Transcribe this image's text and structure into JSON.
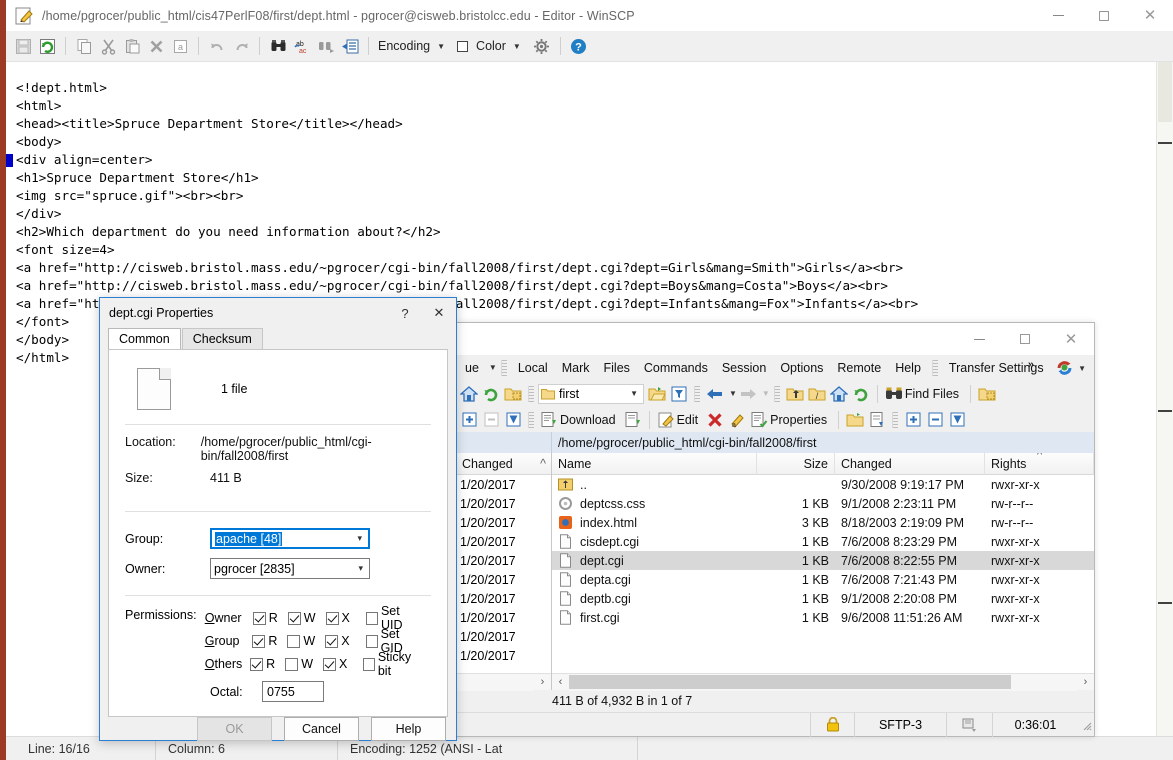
{
  "editor": {
    "title": "/home/pgrocer/public_html/cis47PerlF08/first/dept.html - pgrocer@cisweb.bristolcc.edu - Editor - WinSCP",
    "title_icon": "edit-pencil-icon",
    "toolbar": {
      "save_icon": "save-icon",
      "reload_icon": "reload-icon",
      "copy_icon": "copy-icon",
      "cut_icon": "cut-icon",
      "paste_icon": "paste-icon",
      "delete_icon": "delete-x-icon",
      "select_all_icon": "select-all-icon",
      "undo_icon": "undo-icon",
      "redo_icon": "redo-icon",
      "find_icon": "find-binoculars-icon",
      "replace_icon": "replace-icon",
      "find_next_icon": "find-next-icon",
      "goto_icon": "go-to-line-icon",
      "encoding_label": "Encoding",
      "color_label": "Color",
      "preferences_icon": "gear-icon",
      "help_icon": "help-question-icon"
    },
    "code_lines": [
      "<!dept.html>",
      "<html>",
      "<head><title>Spruce Department Store</title></head>",
      "<body>",
      "<div align=center>",
      "<h1>Spruce Department Store</h1>",
      "<img src=\"spruce.gif\"><br><br>",
      "</div>",
      "<h2>Which department do you need information about?</h2>",
      "<font size=4>",
      "<a href=\"http://cisweb.bristol.mass.edu/~pgrocer/cgi-bin/fall2008/first/dept.cgi?dept=Girls&mang=Smith\">Girls</a><br>",
      "<a href=\"http://cisweb.bristol.mass.edu/~pgrocer/cgi-bin/fall2008/first/dept.cgi?dept=Boys&mang=Costa\">Boys</a><br>",
      "<a href=\"http://cisweb.bristol.mass.edu/~pgrocer/cgi-bin/fall2008/first/dept.cgi?dept=Infants&mang=Fox\">Infants</a><br>",
      "</font>",
      "</body>",
      "</html>"
    ],
    "status": {
      "line": "Line: 16/16",
      "column": "Column: 6",
      "encoding": "Encoding: 1252 (ANSI - Lat"
    },
    "window_buttons": {
      "minimize": "minimize-button",
      "maximize": "maximize-button",
      "close": "close-button"
    }
  },
  "winscp": {
    "menus": [
      "Local",
      "Mark",
      "Files",
      "Commands",
      "Session",
      "Options",
      "Remote",
      "Help",
      "Transfer Settings"
    ],
    "queue_label": "ue",
    "overflow_label": "»",
    "toolbar_path_value": "first",
    "find_files_label": "Find Files",
    "actions": {
      "download_label": "Download",
      "edit_label": "Edit",
      "properties_label": "Properties"
    },
    "remote_path": "/home/pgrocer/public_html/cgi-bin/fall2008/first",
    "left_panel": {
      "column_header": "Changed",
      "rows": [
        "1/20/2017",
        "1/20/2017",
        "1/20/2017",
        "1/20/2017",
        "1/20/2017",
        "1/20/2017",
        "1/20/2017",
        "1/20/2017",
        "1/20/2017",
        "1/20/2017"
      ]
    },
    "columns": [
      "Name",
      "Size",
      "Changed",
      "Rights",
      ""
    ],
    "files": [
      {
        "icon": "parent-folder-icon",
        "name": "..",
        "size": "",
        "changed": "9/30/2008 9:19:17 PM",
        "rights": "rwxr-xr-x",
        "selected": false
      },
      {
        "icon": "css-file-icon",
        "name": "deptcss.css",
        "size": "1 KB",
        "changed": "9/1/2008 2:23:11 PM",
        "rights": "rw-r--r--",
        "selected": false
      },
      {
        "icon": "html-file-icon",
        "name": "index.html",
        "size": "3 KB",
        "changed": "8/18/2003 2:19:09 PM",
        "rights": "rw-r--r--",
        "selected": false
      },
      {
        "icon": "generic-file-icon",
        "name": "cisdept.cgi",
        "size": "1 KB",
        "changed": "7/6/2008 8:23:29 PM",
        "rights": "rwxr-xr-x",
        "selected": false
      },
      {
        "icon": "generic-file-icon",
        "name": "dept.cgi",
        "size": "1 KB",
        "changed": "7/6/2008 8:22:55 PM",
        "rights": "rwxr-xr-x",
        "selected": true
      },
      {
        "icon": "generic-file-icon",
        "name": "depta.cgi",
        "size": "1 KB",
        "changed": "7/6/2008 7:21:43 PM",
        "rights": "rwxr-xr-x",
        "selected": false
      },
      {
        "icon": "generic-file-icon",
        "name": "deptb.cgi",
        "size": "1 KB",
        "changed": "9/1/2008 2:20:08 PM",
        "rights": "rwxr-xr-x",
        "selected": false
      },
      {
        "icon": "generic-file-icon",
        "name": "first.cgi",
        "size": "1 KB",
        "changed": "9/6/2008 11:51:26 AM",
        "rights": "rwxr-xr-x",
        "selected": false
      }
    ],
    "status_selection": "411 B of 4,932 B in 1 of 7",
    "bottom": {
      "lock_icon": "lock-icon",
      "protocol": "SFTP-3",
      "transfer_icon": "transfer-icon",
      "elapsed": "0:36:01"
    },
    "window_buttons": {
      "minimize": "minimize-button",
      "maximize": "maximize-button",
      "close": "close-button"
    }
  },
  "dialog": {
    "title": "dept.cgi Properties",
    "help_button": "?",
    "close_button": "✕",
    "tabs": [
      {
        "label": "Common",
        "active": true
      },
      {
        "label": "Checksum",
        "active": false
      }
    ],
    "file_count": "1 file",
    "location_label": "Location:",
    "location_value": "/home/pgrocer/public_html/cgi-bin/fall2008/first",
    "size_label": "Size:",
    "size_value": "411 B",
    "group_label": "Group:",
    "group_value": "apache [48]",
    "owner_label": "Owner:",
    "owner_value": "pgrocer [2835]",
    "permissions_label": "Permissions:",
    "perm_rows": [
      {
        "name": "Owner",
        "r": true,
        "w": true,
        "x": true,
        "extra_label": "Set UID",
        "extra": false
      },
      {
        "name": "Group",
        "r": true,
        "w": false,
        "x": true,
        "extra_label": "Set GID",
        "extra": false
      },
      {
        "name": "Others",
        "r": true,
        "w": false,
        "x": true,
        "extra_label": "Sticky bit",
        "extra": false
      }
    ],
    "octal_label": "Octal:",
    "octal_value": "0755",
    "buttons": [
      {
        "label": "OK",
        "disabled": true
      },
      {
        "label": "Cancel",
        "disabled": false
      },
      {
        "label": "Help",
        "disabled": false
      }
    ]
  },
  "colors": {
    "accent": "#0078d7",
    "dialog_border": "#2a7fd4",
    "editor_accent": "#9c3b23",
    "path_bar": "#dfe8f2",
    "selection": "#d8d8d8"
  }
}
